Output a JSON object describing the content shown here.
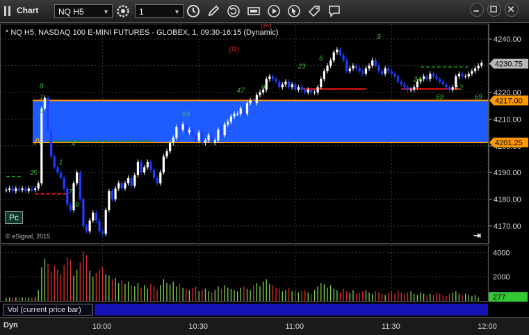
{
  "toolbar": {
    "title": "Chart",
    "symbol": "NQ H5",
    "interval": "1"
  },
  "header": {
    "symbol_title": "* NQ H5, NASDAQ 100 E-MINI FUTURES - GLOBEX, 1, 09:30-16:15 (Dynamic)",
    "r_marker": "(R)",
    "brand": "© eSignal, 2015",
    "pc_label": "Pc",
    "a_marker": "A"
  },
  "colors": {
    "zone": "#1e5cff",
    "zone_border": "#ff9900",
    "up_bar": "#ffffff",
    "down_bar": "#1d3dff",
    "vol_up": "#7fd64a",
    "vol_down": "#e0302a",
    "green_dash": "#1a8a1a",
    "red_line": "#e01010",
    "last_price_bg": "#b8b8b8",
    "level_bg": "#ff9900"
  },
  "chart_data": {
    "type": "candlestick",
    "y_ticks": [
      4240,
      4230,
      4220,
      4210,
      4200,
      4190,
      4180,
      4170
    ],
    "y_tick_labels": [
      "4240.00",
      "4230.75",
      "4220.00",
      "4210.00",
      "4200.00",
      "4190.00",
      "4180.00",
      "4170.00"
    ],
    "ylim": [
      4163.5,
      4245.5
    ],
    "x_ticks": [
      "10:00",
      "10:30",
      "11:00",
      "11:30",
      "12:00"
    ],
    "x_tick_minutes": [
      30,
      60,
      90,
      120,
      150
    ],
    "last_price": "4230.75",
    "zone": {
      "top": 4217.0,
      "bottom": 4201.25,
      "top_label": "4217.00",
      "bottom_label": "4201.25"
    },
    "closes": [
      4183.5,
      4184,
      4183,
      4184,
      4183.5,
      4184,
      4183,
      4184,
      4183.5,
      4184,
      4186,
      4214,
      4218,
      4206,
      4196,
      4192,
      4190,
      4188,
      4184,
      4178,
      4176,
      4186,
      4190,
      4180,
      4170,
      4168,
      4172,
      4175,
      4172,
      4168,
      4167,
      4176,
      4183,
      4180,
      4184,
      4186,
      4184,
      4186,
      4188,
      4185,
      4189,
      4194,
      4190,
      4192,
      4194,
      4191,
      4188,
      4186,
      4190,
      4196,
      4198,
      4201,
      4203,
      4207,
      4206,
      4208,
      4205,
      4206,
      4204,
      4202,
      4205,
      4201,
      4202,
      4204,
      4201,
      4202,
      4206,
      4204,
      4208,
      4209,
      4211,
      4212,
      4212,
      4214,
      4212,
      4216,
      4217,
      4216,
      4219,
      4220,
      4221,
      4225,
      4226,
      4225,
      4224,
      4222,
      4223,
      4224,
      4222,
      4223,
      4221,
      4222,
      4221,
      4220,
      4221,
      4220,
      4220,
      4222,
      4225,
      4228,
      4230,
      4232,
      4235,
      4236,
      4234,
      4232,
      4228,
      4229,
      4230,
      4229,
      4228,
      4227,
      4229,
      4230,
      4232,
      4230,
      4228,
      4227,
      4229,
      4228,
      4227,
      4226,
      4224,
      4223,
      4222,
      4221,
      4221,
      4222,
      4224,
      4225,
      4226,
      4225,
      4227,
      4226,
      4225,
      4224,
      4223,
      4222,
      4221,
      4222,
      4226,
      4227,
      4226,
      4226,
      4227,
      4228,
      4229,
      4230,
      4231
    ],
    "volume_ylim": [
      0,
      4600
    ],
    "volume_ticks": [
      4000,
      2000
    ],
    "volume_tick_labels": [
      "4000",
      "2000"
    ],
    "last_volume": "277",
    "volumes": [
      250,
      280,
      240,
      300,
      260,
      310,
      270,
      280,
      250,
      300,
      900,
      2800,
      3500,
      3100,
      2400,
      2900,
      2600,
      2200,
      3000,
      3600,
      3400,
      2100,
      2600,
      3200,
      4100,
      3800,
      2500,
      2000,
      2300,
      2600,
      2800,
      2200,
      2100,
      1800,
      1900,
      1500,
      1700,
      1400,
      1600,
      1300,
      1200,
      1500,
      1100,
      1300,
      1000,
      1400,
      1200,
      900,
      1300,
      1800,
      1500,
      1400,
      1600,
      1200,
      1400,
      1100,
      1000,
      900,
      1100,
      1200,
      800,
      900,
      1000,
      800,
      700,
      900,
      1200,
      1000,
      1300,
      1100,
      1000,
      900,
      800,
      1100,
      1200,
      1000,
      900,
      1300,
      1500,
      1200,
      1600,
      1800,
      1400,
      1300,
      1100,
      1000,
      800,
      900,
      1100,
      800,
      900,
      700,
      800,
      900,
      700,
      600,
      900,
      1200,
      1500,
      1400,
      1100,
      1300,
      1000,
      900,
      700,
      1000,
      800,
      700,
      900,
      600,
      700,
      800,
      900,
      700,
      600,
      800,
      700,
      600,
      500,
      700,
      800,
      600,
      900,
      700,
      600,
      700,
      800,
      600,
      500,
      700,
      600,
      500,
      600,
      500,
      700,
      600,
      500,
      400,
      600,
      700,
      800,
      600,
      500,
      600,
      500,
      400,
      500,
      277
    ],
    "support_lines": [
      {
        "kind": "green-dash",
        "price": 4201.7,
        "from": 13,
        "to": 46
      },
      {
        "kind": "green-dash",
        "price": 4188.5,
        "from": 0,
        "to": 5
      },
      {
        "kind": "red-dash",
        "price": 4182,
        "from": 9,
        "to": 19
      },
      {
        "kind": "red-solid",
        "price": 4221.3,
        "from": 92,
        "to": 112
      },
      {
        "kind": "red-solid",
        "price": 4221.3,
        "from": 123,
        "to": 141
      },
      {
        "kind": "green-dash",
        "price": 4229.5,
        "from": 129,
        "to": 144
      }
    ],
    "annotations": [
      {
        "text": "1",
        "bar": 11,
        "price": 4217.5
      },
      {
        "text": "8",
        "bar": 11,
        "price": 4221.5
      },
      {
        "text": "2",
        "bar": 11,
        "price": 4212.5
      },
      {
        "text": "2",
        "bar": 8,
        "price": 4189
      },
      {
        "text": "5",
        "bar": 9,
        "price": 4189
      },
      {
        "text": "1",
        "bar": 17,
        "price": 4193
      },
      {
        "text": "7",
        "bar": 20,
        "price": 4182
      },
      {
        "text": "9",
        "bar": 22,
        "price": 4177
      },
      {
        "text": "4",
        "bar": 21,
        "price": 4200
      },
      {
        "text": "89",
        "bar": 56,
        "price": 4211
      },
      {
        "text": "47",
        "bar": 73,
        "price": 4220
      },
      {
        "text": "9",
        "bar": 80,
        "price": 4221
      },
      {
        "text": "23",
        "bar": 92,
        "price": 4229
      },
      {
        "text": "6",
        "bar": 98,
        "price": 4232
      },
      {
        "text": "9",
        "bar": 116,
        "price": 4240
      },
      {
        "text": "24",
        "bar": 128,
        "price": 4224
      },
      {
        "text": "69",
        "bar": 135,
        "price": 4217.5
      },
      {
        "text": "12",
        "bar": 141,
        "price": 4221
      },
      {
        "text": "69",
        "bar": 147,
        "price": 4217.5
      }
    ]
  }
}
